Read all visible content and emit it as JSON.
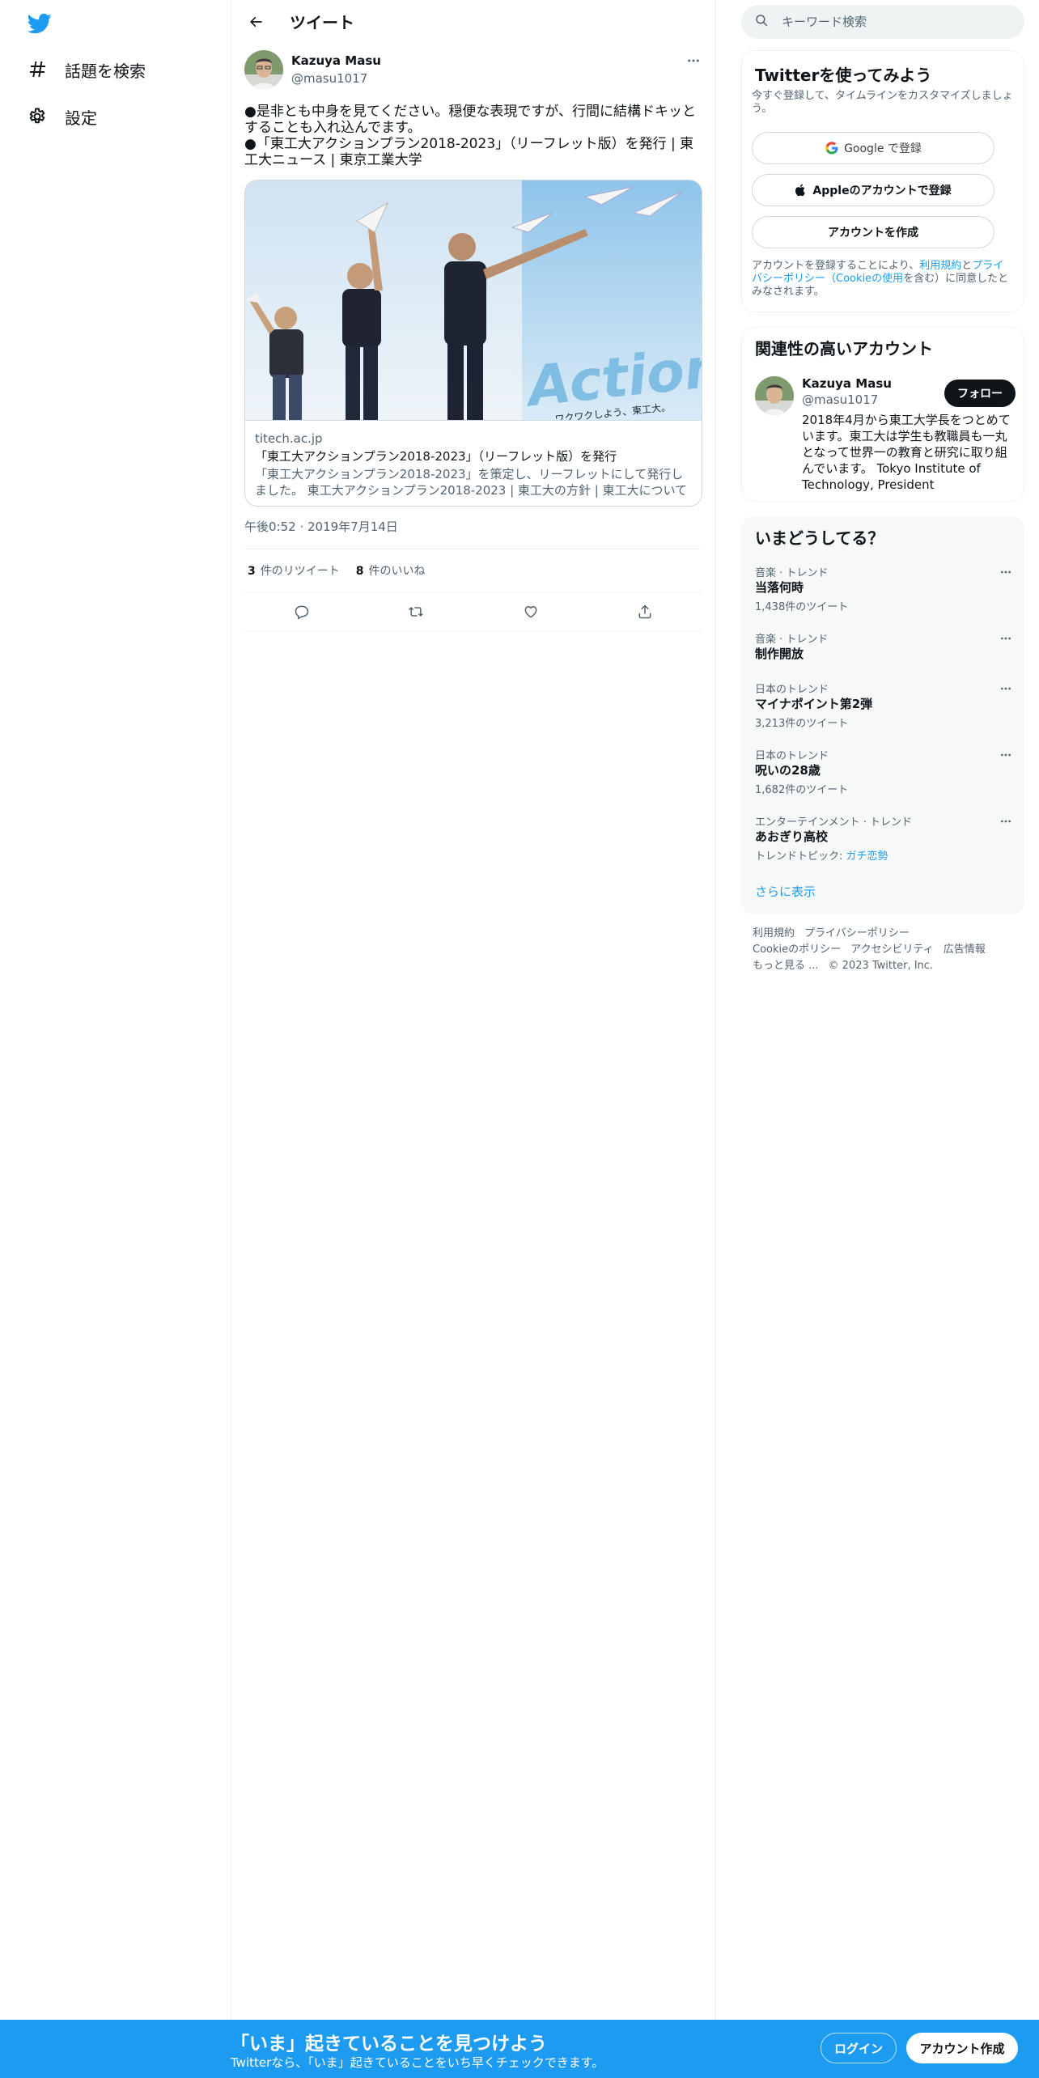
{
  "colors": {
    "brand": "#1d9bf0",
    "text": "#0f1419",
    "muted": "#536471",
    "border": "#eff3f4"
  },
  "nav": {
    "items": [
      {
        "label": "話題を検索",
        "icon": "hashtag-icon"
      },
      {
        "label": "設定",
        "icon": "gear-icon"
      }
    ]
  },
  "header": {
    "title": "ツイート"
  },
  "tweet": {
    "author_name": "Kazuya Masu",
    "author_handle": "@masu1017",
    "text": "●是非とも中身を見てください。穏便な表現ですが、行間に結構ドキッとすることも入れ込んでます。\n●「東工大アクションプラン2018-2023」（リーフレット版）を発行 | 東工大ニュース | 東京工業大学",
    "card": {
      "domain": "titech.ac.jp",
      "title": "「東工大アクションプラン2018-2023」（リーフレット版）を発行",
      "description": "「東工大アクションプラン2018-2023」を策定し、リーフレットにして発行しました。 東工大アクションプラン2018-2023 | 東工大の方針 | 東工大について 東...",
      "image_text": "Action!",
      "image_caption": "ワクワクしよう、東工大。"
    },
    "timestamp": "午後0:52 · 2019年7月14日",
    "retweets": "3",
    "retweets_label": "件のリツイート",
    "likes": "8",
    "likes_label": "件のいいね"
  },
  "search": {
    "placeholder": "キーワード検索"
  },
  "signup": {
    "title": "Twitterを使ってみよう",
    "subtitle": "今すぐ登録して、タイムラインをカスタマイズしましょう。",
    "google_label": "Google で登録",
    "apple_label": "Appleのアカウントで登録",
    "create_label": "アカウントを作成",
    "legal_prefix": "アカウントを登録することにより、",
    "terms_link": "利用規約",
    "and": "と",
    "privacy_link": "プライバシーポリシー",
    "paren_open": "（",
    "cookie_link": "Cookieの使用",
    "legal_suffix": "を含む）に同意したとみなされます。"
  },
  "related": {
    "title": "関連性の高いアカウント",
    "name": "Kazuya Masu",
    "handle": "@masu1017",
    "follow_label": "フォロー",
    "bio": "2018年4月から東工大学長をつとめています。東工大は学生も教職員も一丸となって世界一の教育と研究に取り組んでいます。 Tokyo Institute of Technology, President"
  },
  "trends": {
    "title": "いまどうしてる？",
    "items": [
      {
        "category": "音楽 · トレンド",
        "name": "当落何時",
        "count": "1,438件のツイート"
      },
      {
        "category": "音楽 · トレンド",
        "name": "制作開放",
        "count": ""
      },
      {
        "category": "日本のトレンド",
        "name": "マイナポイント第2弾",
        "count": "3,213件のツイート"
      },
      {
        "category": "日本のトレンド",
        "name": "呪いの28歳",
        "count": "1,682件のツイート"
      },
      {
        "category": "エンターテインメント · トレンド",
        "name": "あおぎり高校",
        "count_prefix": "トレンドトピック: ",
        "count_link": "ガチ恋勢"
      }
    ],
    "show_more": "さらに表示"
  },
  "footer": {
    "links": [
      "利用規約",
      "プライバシーポリシー",
      "Cookieのポリシー",
      "アクセシビリティ",
      "広告情報",
      "もっと見る ..."
    ],
    "copyright": "© 2023 Twitter, Inc."
  },
  "banner": {
    "title": "「いま」起きていることを見つけよう",
    "subtitle": "Twitterなら、「いま」起きていることをいち早くチェックできます。",
    "login_label": "ログイン",
    "signup_label": "アカウント作成"
  }
}
